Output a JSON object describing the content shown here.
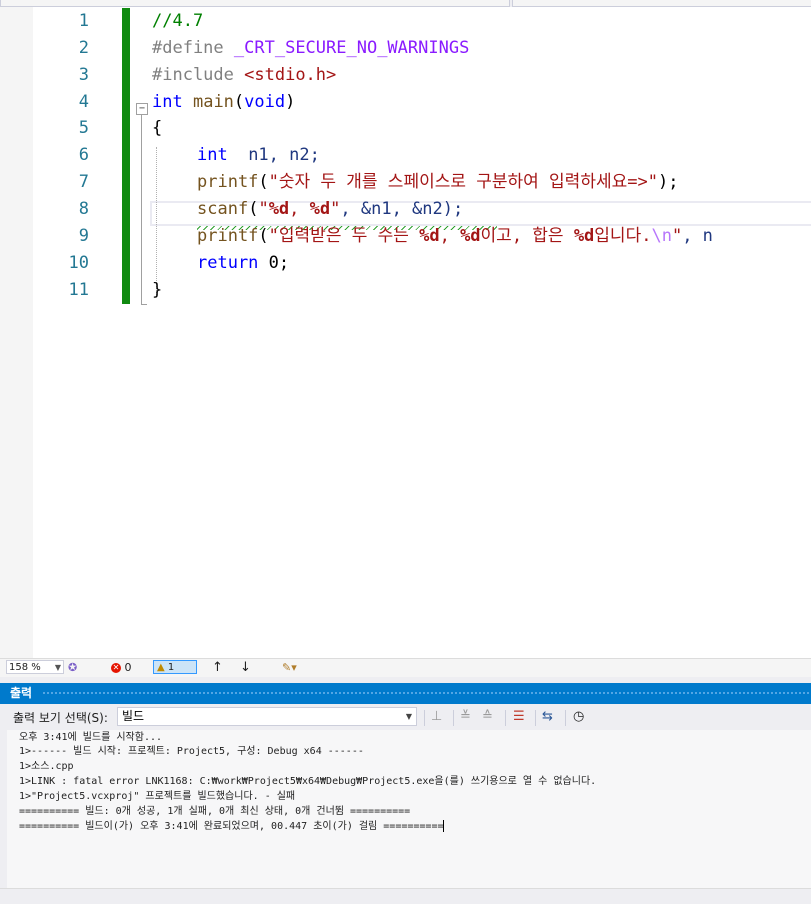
{
  "editor": {
    "line_numbers": [
      "1",
      "2",
      "3",
      "4",
      "5",
      "6",
      "7",
      "8",
      "9",
      "10",
      "11"
    ],
    "fold_glyph": "−",
    "code": {
      "l1": "//4.7",
      "l2_kw": "#define",
      "l2_macro": "_CRT_SECURE_NO_WARNINGS",
      "l3_kw": "#include",
      "l3_hdr": "<stdio.h>",
      "l4_type": "int",
      "l4_fn": "main",
      "l4_paren_open": "(",
      "l4_void": "void",
      "l4_paren_close": ")",
      "l5": "{",
      "l6_type": "int",
      "l6_rest": "  n1, n2;",
      "l7_fn": "printf",
      "l7_open": "(",
      "l7_str": "\"숫자 두 개를 스페이스로 구분하여 입력하세요=>\"",
      "l7_close": ");",
      "l8_fn": "scanf",
      "l8_open": "(",
      "l8_q1": "\"",
      "l8_f1": "%d",
      "l8_mid": ", ",
      "l8_f2": "%d",
      "l8_q2": "\"",
      "l8_rest": ", &n1, &n2);",
      "l9_fn": "printf",
      "l9_open": "(",
      "l9_s1": "\"입력받은 두 수는 ",
      "l9_f1": "%d",
      "l9_s2": ", ",
      "l9_f2": "%d",
      "l9_s3": "이고, 합은 ",
      "l9_f3": "%d",
      "l9_s4": "입니다.",
      "l9_esc": "\\n",
      "l9_s5": "\"",
      "l9_rest": ", n",
      "l10_kw": "return",
      "l10_rest": " 0;",
      "l11": "}"
    }
  },
  "statusbar": {
    "zoom": "158 %",
    "errors": "0",
    "warnings": "1",
    "up_arrow": "↑",
    "down_arrow": "↓"
  },
  "output": {
    "title": "출력",
    "show_label": "출력 보기 선택(S):",
    "source": "빌드",
    "lines": [
      "오후 3:41에 빌드를 시작함...",
      "1>------ 빌드 시작: 프로젝트: Project5, 구성: Debug x64 ------",
      "1>소스.cpp",
      "1>LINK : fatal error LNK1168: C:₩work₩Project5₩x64₩Debug₩Project5.exe을(를) 쓰기용으로 열 수 없습니다.",
      "1>\"Project5.vcxproj\" 프로젝트를 빌드했습니다. - 실패",
      "========== 빌드: 0개 성공, 1개 실패, 0개 최신 상태, 0개 건너뜀 ==========",
      "========== 빌드이(가) 오후 3:41에 완료되었으며, 00.447 초이(가) 걸림 =========="
    ]
  }
}
